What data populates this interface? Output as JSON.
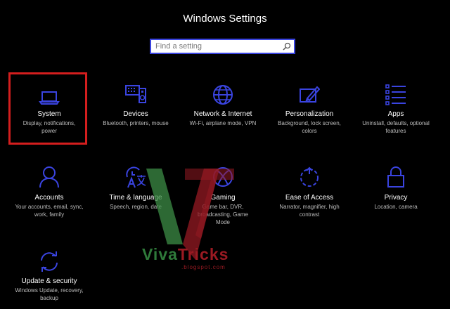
{
  "window": {
    "title": "Windows Settings"
  },
  "search": {
    "placeholder": "Find a setting",
    "value": ""
  },
  "accent_color": "#3a44e0",
  "selection_color": "#d41e1e",
  "tiles": [
    {
      "label": "System",
      "desc": "Display, notifications, power",
      "icon": "laptop-icon",
      "selected": true
    },
    {
      "label": "Devices",
      "desc": "Bluetooth, printers, mouse",
      "icon": "devices-icon"
    },
    {
      "label": "Network & Internet",
      "desc": "Wi-Fi, airplane mode, VPN",
      "icon": "globe-icon"
    },
    {
      "label": "Personalization",
      "desc": "Background, lock screen, colors",
      "icon": "paint-icon"
    },
    {
      "label": "Apps",
      "desc": "Uninstall, defaults, optional features",
      "icon": "apps-list-icon"
    },
    {
      "label": "Accounts",
      "desc": "Your accounts, email, sync, work, family",
      "icon": "person-icon"
    },
    {
      "label": "Time & language",
      "desc": "Speech, region, date",
      "icon": "time-language-icon"
    },
    {
      "label": "Gaming",
      "desc": "Game bar, DVR, broadcasting, Game Mode",
      "icon": "xbox-icon"
    },
    {
      "label": "Ease of Access",
      "desc": "Narrator, magnifier, high contrast",
      "icon": "ease-of-access-icon"
    },
    {
      "label": "Privacy",
      "desc": "Location, camera",
      "icon": "lock-icon"
    },
    {
      "label": "Update & security",
      "desc": "Windows Update, recovery, backup",
      "icon": "sync-icon"
    }
  ],
  "watermark": {
    "text_viva": "Viva",
    "text_tricks": "Tricks",
    "subtext": ".blogspot.com"
  }
}
